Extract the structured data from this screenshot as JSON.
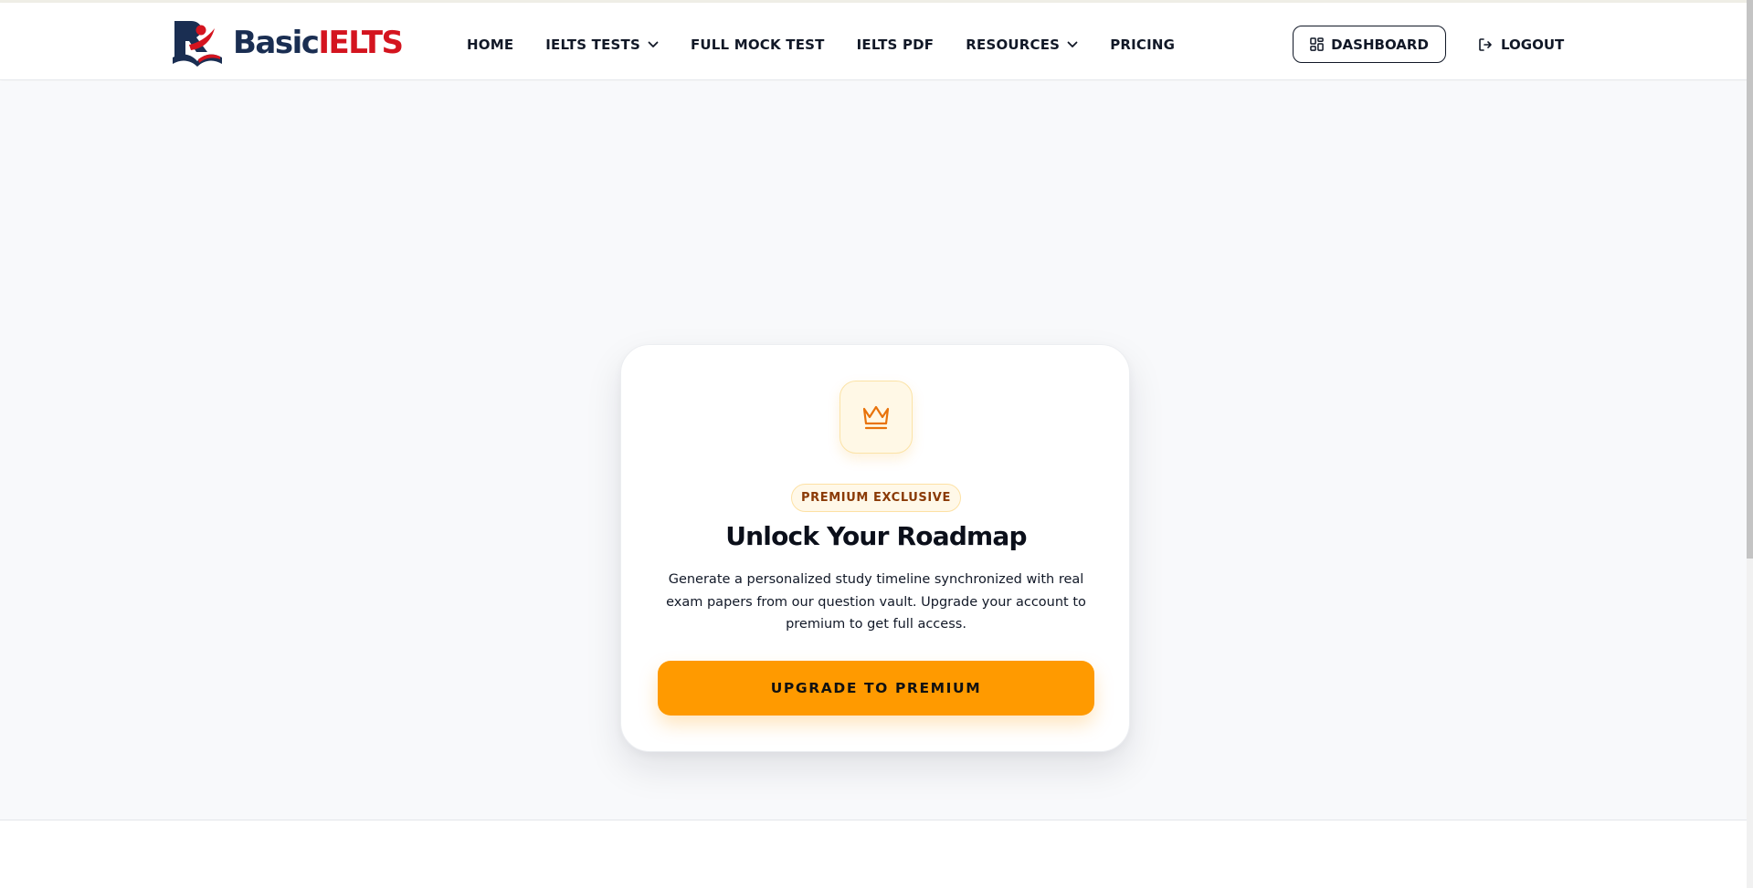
{
  "brand": {
    "name_part1": "Basic",
    "name_part2": "IELTS",
    "color_primary": "#1a2e52",
    "color_accent": "#d4141f"
  },
  "nav": {
    "items": [
      {
        "label": "HOME",
        "has_dropdown": false
      },
      {
        "label": "IELTS TESTS",
        "has_dropdown": true
      },
      {
        "label": "FULL MOCK TEST",
        "has_dropdown": false
      },
      {
        "label": "IELTS PDF",
        "has_dropdown": false
      },
      {
        "label": "RESOURCES",
        "has_dropdown": true
      },
      {
        "label": "PRICING",
        "has_dropdown": false
      }
    ]
  },
  "actions": {
    "dashboard_label": "DASHBOARD",
    "logout_label": "LOGOUT"
  },
  "card": {
    "icon": "crown-icon",
    "badge": "PREMIUM EXCLUSIVE",
    "title": "Unlock Your Roadmap",
    "description": "Generate a personalized study timeline synchronized with real exam papers from our question vault. Upgrade your account to premium to get full access.",
    "cta_label": "UPGRADE TO PREMIUM",
    "cta_color": "#ff9a00",
    "badge_text_color": "#8a3a06"
  }
}
